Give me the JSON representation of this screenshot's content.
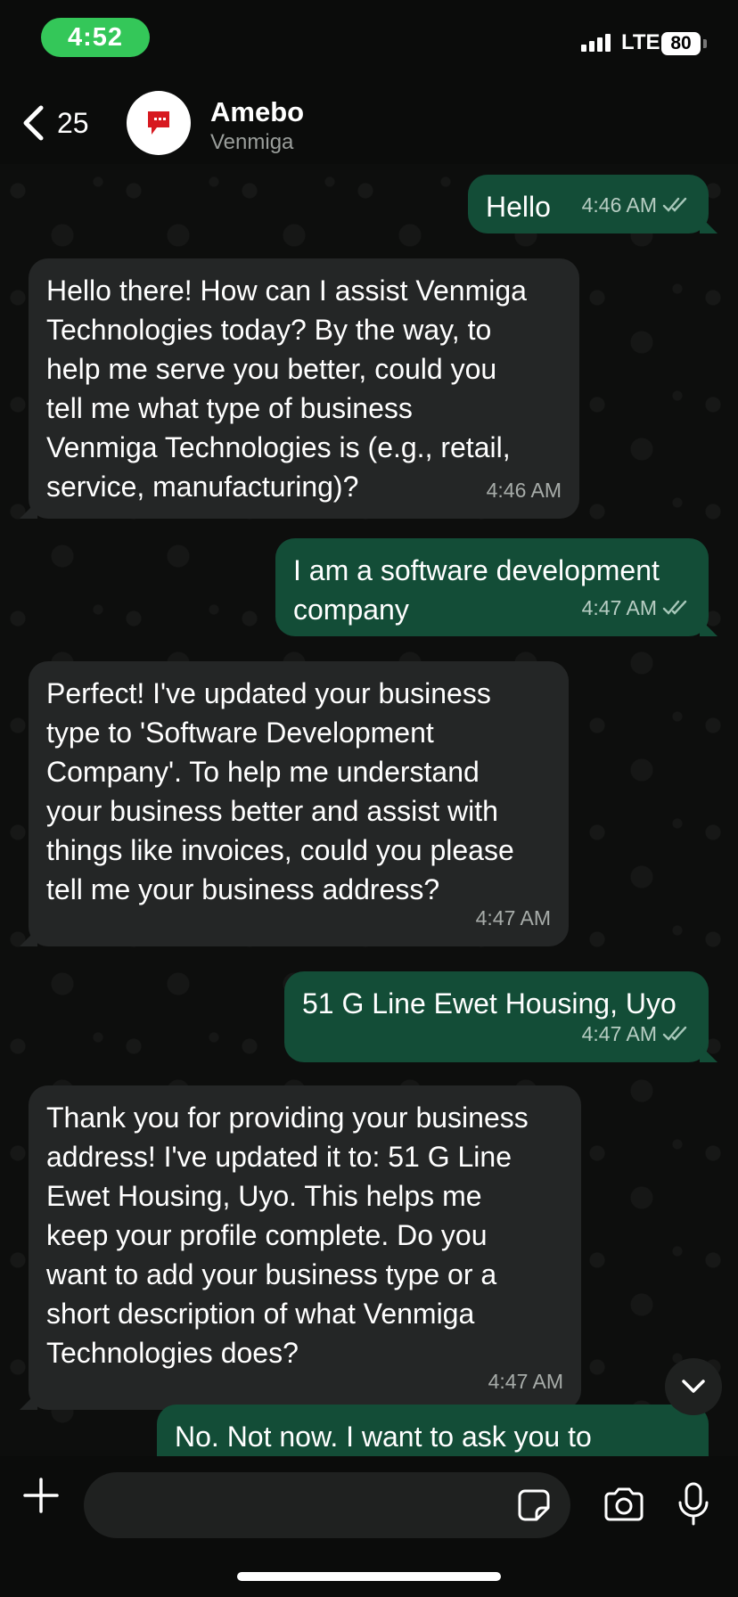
{
  "status": {
    "time": "4:52",
    "network": "LTE",
    "battery": "80"
  },
  "header": {
    "back_count": "25",
    "contact_name": "Amebo",
    "contact_subtitle": "Venmiga"
  },
  "messages": [
    {
      "dir": "out",
      "text": "Hello",
      "time": "4:46 AM",
      "read": true
    },
    {
      "dir": "in",
      "text": "Hello there! How can I assist Venmiga\nTechnologies today? By the way, to\nhelp me serve you better, could you\ntell me what type of business\nVenmiga Technologies is (e.g., retail,\nservice, manufacturing)?",
      "time": "4:46 AM"
    },
    {
      "dir": "out",
      "text": "I am a software development\ncompany",
      "time": "4:47 AM",
      "read": true
    },
    {
      "dir": "in",
      "text": "Perfect! I've updated your business\ntype to 'Software Development\nCompany'. To help me understand\nyour business better and assist with\nthings like invoices, could you please\ntell me your business address?",
      "time": "4:47 AM"
    },
    {
      "dir": "out",
      "text": "51 G Line Ewet Housing, Uyo",
      "time": "4:47 AM",
      "read": true
    },
    {
      "dir": "in",
      "text": "Thank you for providing your business\naddress! I've updated it to: 51 G Line\nEwet Housing, Uyo. This helps me\nkeep your profile complete. Do you\nwant to add your business type or a\nshort description of what Venmiga\nTechnologies does?",
      "time": "4:47 AM"
    },
    {
      "dir": "out",
      "text": "No. Not now. I want to ask you to",
      "time": "",
      "read": false
    }
  ],
  "composer": {
    "placeholder": ""
  },
  "colors": {
    "status_pill": "#34c759",
    "incoming_bubble": "#242626",
    "outgoing_bubble": "#134d37",
    "background": "#0b0c0b"
  }
}
